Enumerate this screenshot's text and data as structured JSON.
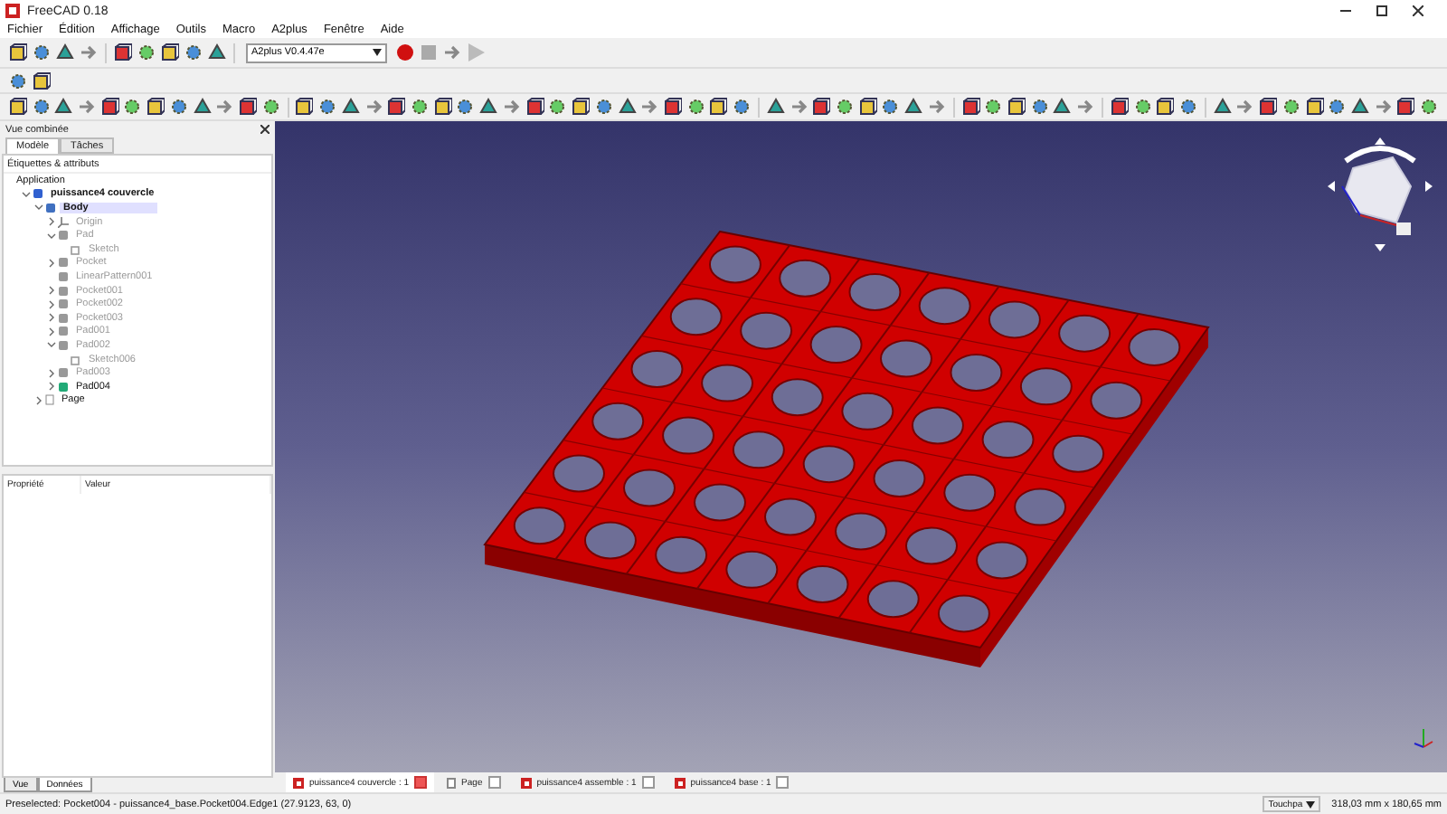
{
  "window": {
    "title": "FreeCAD 0.18"
  },
  "menu": [
    "Fichier",
    "Édition",
    "Affichage",
    "Outils",
    "Macro",
    "A2plus",
    "Fenêtre",
    "Aide"
  ],
  "workbench": {
    "value": "A2plus V0.4.47e"
  },
  "combo_view": {
    "title": "Vue combinée",
    "tabs": [
      {
        "label": "Modèle",
        "selected": true
      },
      {
        "label": "Tâches",
        "selected": false
      }
    ],
    "tree_header": "Étiquettes & attributs",
    "tree_root": "Application",
    "tree": [
      {
        "label": "puissance4 couvercle",
        "kind": "document",
        "bold": true,
        "hidden": false,
        "selected": false,
        "expanded": true,
        "children": [
          {
            "label": "Body",
            "kind": "body",
            "bold": true,
            "hidden": false,
            "selected": true,
            "expanded": true,
            "children": [
              {
                "label": "Origin",
                "kind": "axes",
                "bold": false,
                "hidden": true,
                "selected": false,
                "expanded": false
              },
              {
                "label": "Pad",
                "kind": "feature",
                "bold": false,
                "hidden": true,
                "selected": false,
                "expanded": true,
                "children": [
                  {
                    "label": "Sketch",
                    "kind": "sketch",
                    "bold": false,
                    "hidden": true,
                    "selected": false
                  }
                ]
              },
              {
                "label": "Pocket",
                "kind": "feature",
                "bold": false,
                "hidden": true,
                "selected": false,
                "expanded": false
              },
              {
                "label": "LinearPattern001",
                "kind": "feature",
                "bold": false,
                "hidden": true,
                "selected": false
              },
              {
                "label": "Pocket001",
                "kind": "feature",
                "bold": false,
                "hidden": true,
                "selected": false,
                "expanded": false
              },
              {
                "label": "Pocket002",
                "kind": "feature",
                "bold": false,
                "hidden": true,
                "selected": false,
                "expanded": false
              },
              {
                "label": "Pocket003",
                "kind": "feature",
                "bold": false,
                "hidden": true,
                "selected": false,
                "expanded": false
              },
              {
                "label": "Pad001",
                "kind": "feature",
                "bold": false,
                "hidden": true,
                "selected": false,
                "expanded": false
              },
              {
                "label": "Pad002",
                "kind": "feature",
                "bold": false,
                "hidden": true,
                "selected": false,
                "expanded": true,
                "children": [
                  {
                    "label": "Sketch006",
                    "kind": "sketch",
                    "bold": false,
                    "hidden": true,
                    "selected": false
                  }
                ]
              },
              {
                "label": "Pad003",
                "kind": "feature",
                "bold": false,
                "hidden": true,
                "selected": false,
                "expanded": false
              },
              {
                "label": "Pad004",
                "kind": "tip",
                "bold": false,
                "hidden": false,
                "selected": false,
                "expanded": false
              }
            ]
          },
          {
            "label": "Page",
            "kind": "page",
            "bold": false,
            "hidden": false,
            "selected": false,
            "expanded": false
          }
        ]
      }
    ],
    "property_columns": [
      "Propriété",
      "Valeur"
    ],
    "bottom_tabs": [
      {
        "label": "Vue",
        "selected": false
      },
      {
        "label": "Données",
        "selected": true
      }
    ]
  },
  "documents": [
    {
      "label": "puissance4 couvercle : 1",
      "kind": "document",
      "selected": true
    },
    {
      "label": "Page",
      "kind": "page",
      "selected": false
    },
    {
      "label": "puissance4 assemble : 1",
      "kind": "document",
      "selected": false
    },
    {
      "label": "puissance4 base : 1",
      "kind": "document",
      "selected": false
    }
  ],
  "status_bar": {
    "message": "Preselected: Pocket004 - puissance4_base.Pocket004.Edge1 (27.9123, 63, 0)",
    "navigation": "Touchpa",
    "dimensions": "318,03 mm x 180,65 mm"
  }
}
